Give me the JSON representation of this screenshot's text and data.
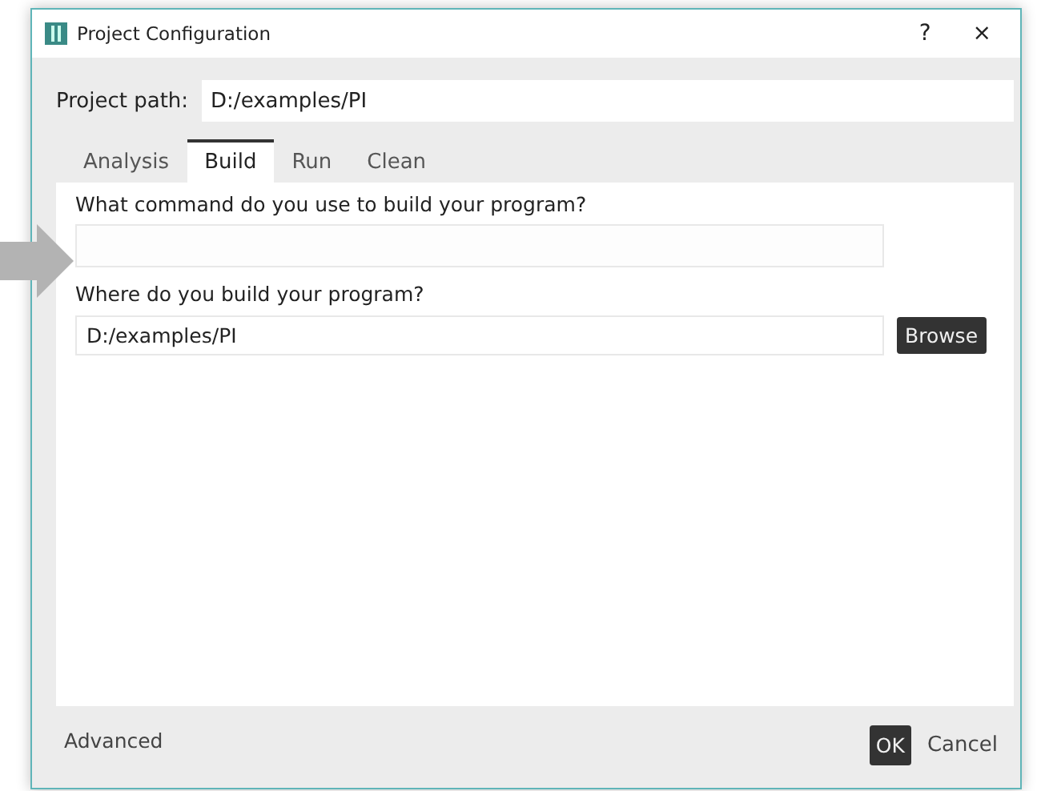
{
  "window": {
    "title": "Project Configuration",
    "help": "?",
    "close": "×"
  },
  "project_path": {
    "label": "Project path:",
    "value": "D:/examples/PI"
  },
  "tabs": [
    {
      "label": "Analysis",
      "selected": false
    },
    {
      "label": "Build",
      "selected": true
    },
    {
      "label": "Run",
      "selected": false
    },
    {
      "label": "Clean",
      "selected": false
    }
  ],
  "build": {
    "command_label": "What command do you use to build your program?",
    "location_label": "Where do you build your program?",
    "location_value": "D:/examples/PI",
    "browse": "Browse"
  },
  "footer": {
    "advanced": "Advanced",
    "ok": "OK",
    "cancel": "Cancel"
  }
}
